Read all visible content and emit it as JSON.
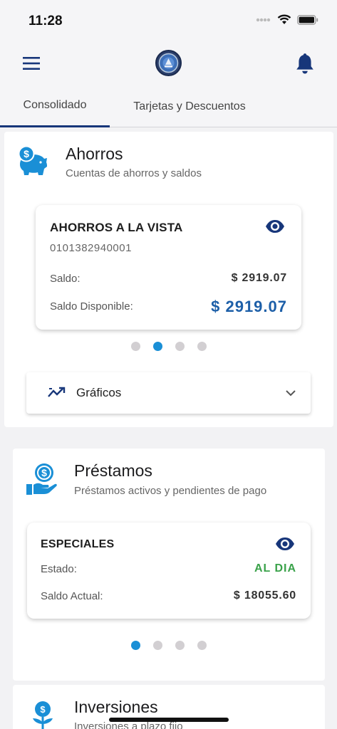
{
  "status_bar": {
    "time": "11:28"
  },
  "tabs": [
    {
      "label": "Consolidado",
      "active": true
    },
    {
      "label": "Tarjetas y Descuentos",
      "active": false
    }
  ],
  "colors": {
    "brand": "#17367a",
    "accent": "#1a8fd6",
    "amount": "#1d5fa8",
    "status_ok": "#3aa24a"
  },
  "savings": {
    "title": "Ahorros",
    "subtitle": "Cuentas de ahorros y saldos",
    "icon": "piggy-bank-icon",
    "account": {
      "name": "AHORROS A LA VISTA",
      "number": "0101382940001",
      "balance_label": "Saldo:",
      "balance": "$ 2919.07",
      "available_label": "Saldo Disponible:",
      "available": "$ 2919.07"
    },
    "carousel_active": 1,
    "charts_label": "Gráficos"
  },
  "loans": {
    "title": "Préstamos",
    "subtitle": "Préstamos activos y pendientes de pago",
    "icon": "hand-money-icon",
    "loan": {
      "name": "ESPECIALES",
      "status_label": "Estado:",
      "status": "AL DIA",
      "balance_label": "Saldo Actual:",
      "balance": "$ 18055.60"
    },
    "carousel_active": 0
  },
  "investments": {
    "title": "Inversiones",
    "subtitle": "Inversiones a plazo fijo",
    "icon": "money-plant-icon"
  }
}
